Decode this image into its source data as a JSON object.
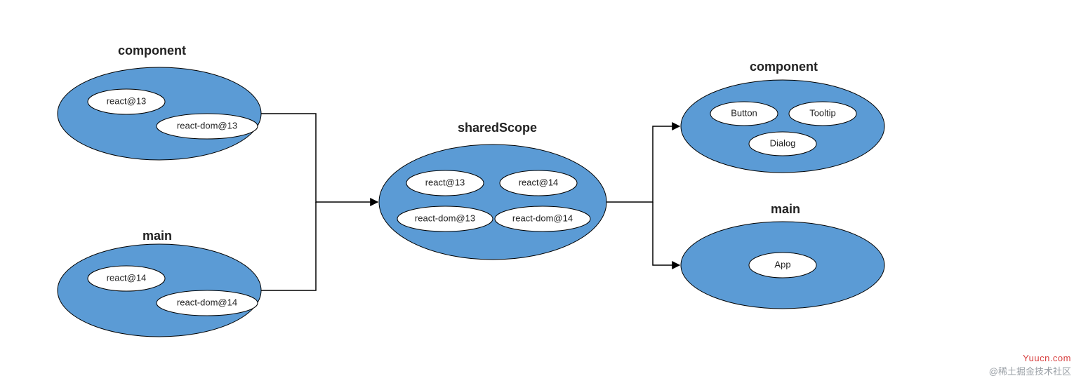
{
  "diagram": {
    "left": {
      "component": {
        "title": "component",
        "items": [
          "react@13",
          "react-dom@13"
        ]
      },
      "main": {
        "title": "main",
        "items": [
          "react@14",
          "react-dom@14"
        ]
      }
    },
    "center": {
      "title": "sharedScope",
      "items": [
        "react@13",
        "react@14",
        "react-dom@13",
        "react-dom@14"
      ]
    },
    "right": {
      "component": {
        "title": "component",
        "items": [
          "Button",
          "Tooltip",
          "Dialog"
        ]
      },
      "main": {
        "title": "main",
        "items": [
          "App"
        ]
      }
    }
  },
  "watermark": {
    "site": "Yuucn.com",
    "credit": "@稀土掘金技术社区"
  },
  "colors": {
    "ellipse_fill": "#5b9bd5",
    "stroke": "#000000",
    "text": "#222222",
    "watermark_site": "#d83f3f",
    "watermark_credit": "#9aa0a6"
  }
}
